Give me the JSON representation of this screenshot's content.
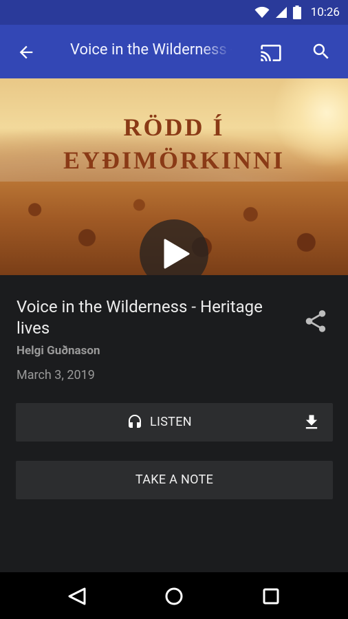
{
  "status": {
    "time": "10:26"
  },
  "appbar": {
    "title": "Voice in the Wilderness - Heritage lives"
  },
  "hero": {
    "line1": "RÖDD Í",
    "line2": "EYÐIMÖRKINNI"
  },
  "episode": {
    "title": "Voice in the Wilderness - Heritage lives",
    "author": "Helgi Guðnason",
    "date": "March 3, 2019"
  },
  "actions": {
    "listen_label": "LISTEN",
    "note_label": "TAKE A NOTE"
  },
  "colors": {
    "appbar": "#3347b5",
    "statusbar": "#2a3a9a",
    "background": "#1b1c1e",
    "button": "#2c2d2f"
  },
  "icons": [
    "wifi-icon",
    "signal-icon",
    "battery-icon",
    "back-arrow-icon",
    "cast-icon",
    "search-icon",
    "play-icon",
    "share-icon",
    "headphones-icon",
    "download-icon",
    "nav-back-icon",
    "nav-home-icon",
    "nav-recent-icon"
  ]
}
